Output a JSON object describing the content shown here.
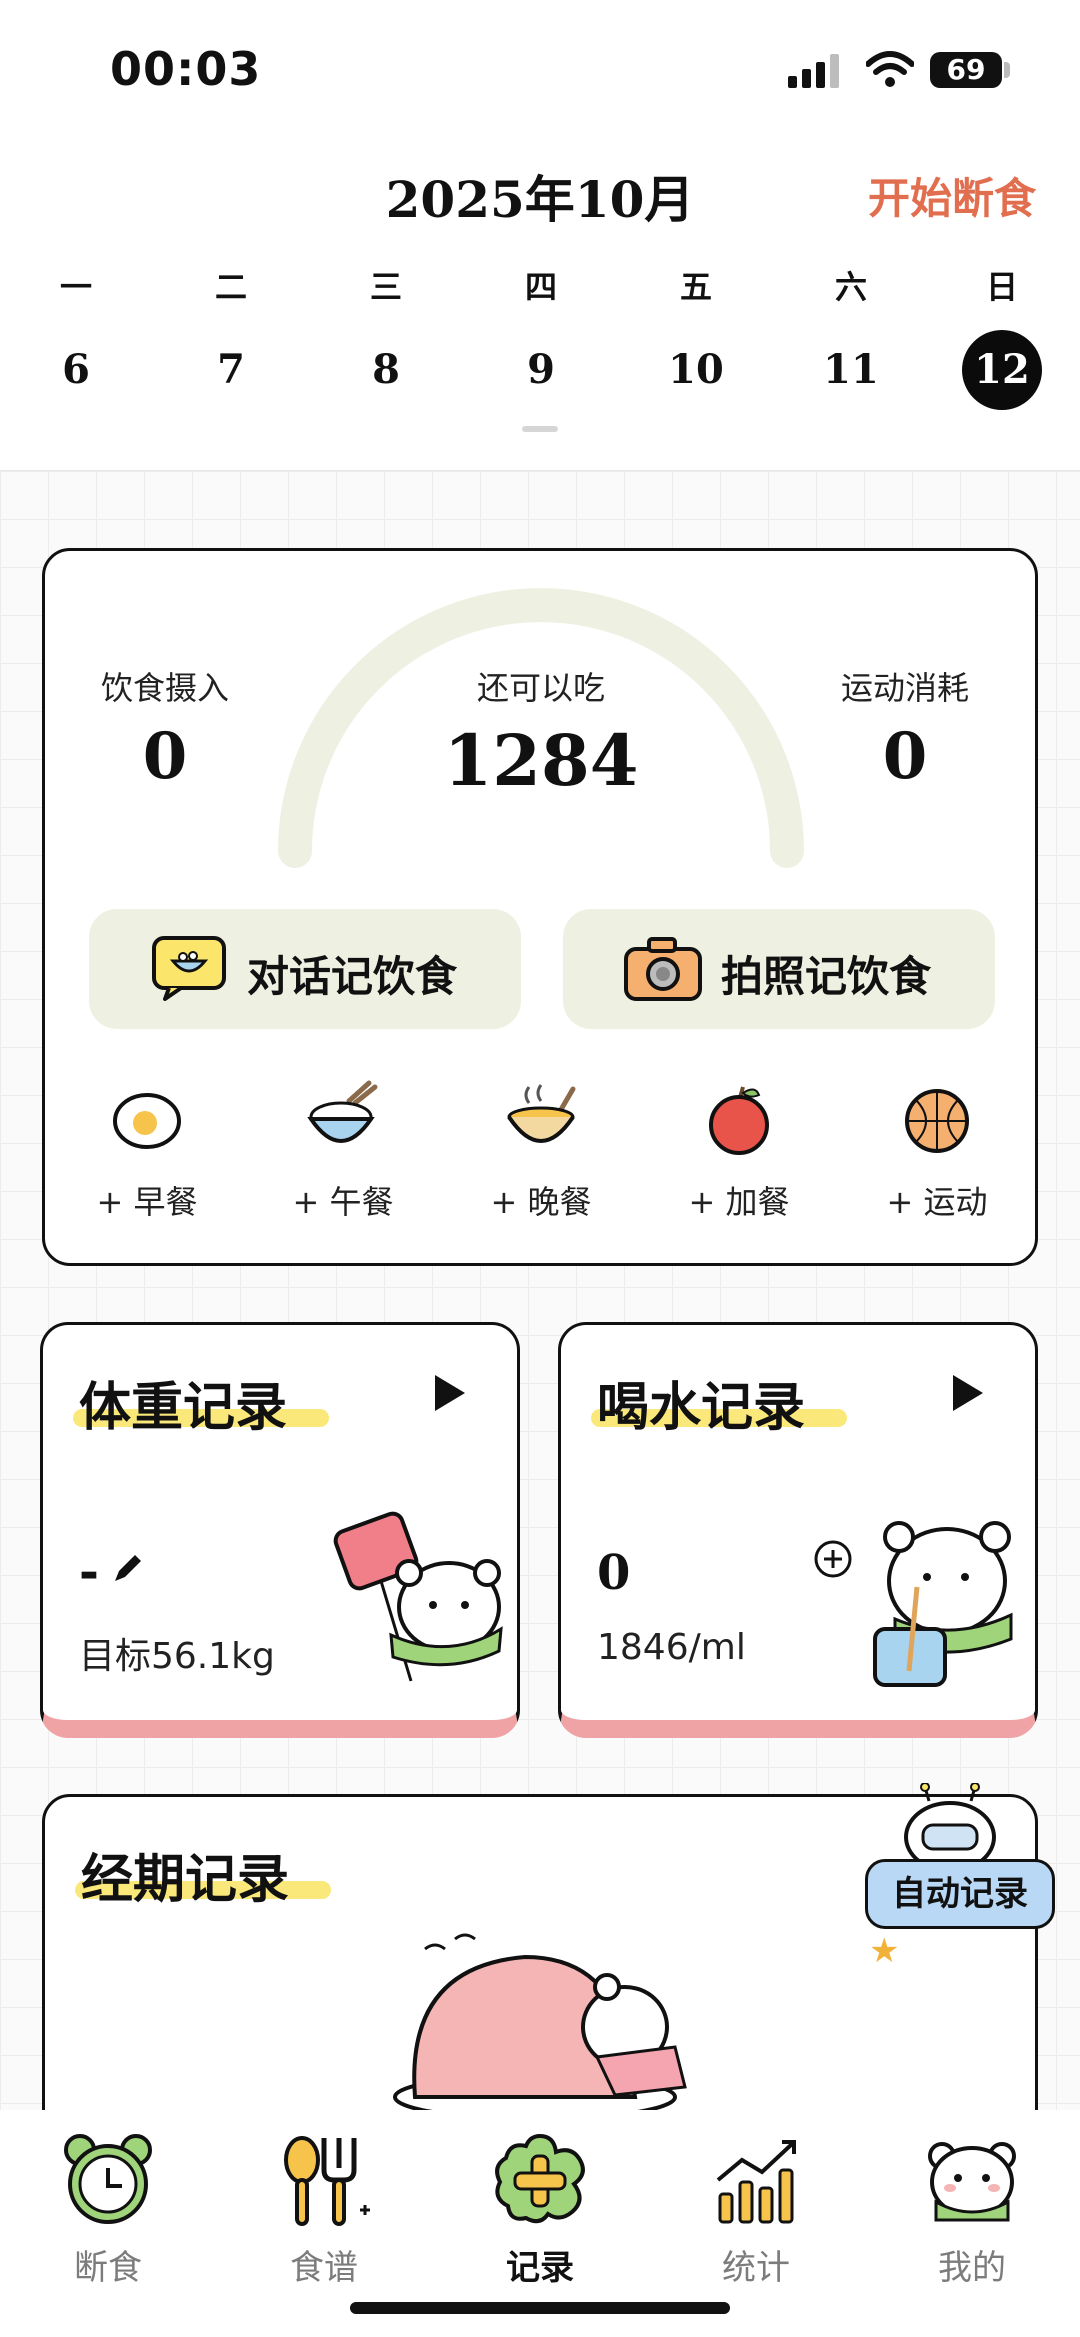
{
  "status": {
    "time": "00:03",
    "battery": "69"
  },
  "calendar": {
    "month_title": "2025年10月",
    "start_fasting": "开始断食",
    "weekdays": [
      "一",
      "二",
      "三",
      "四",
      "五",
      "六",
      "日"
    ],
    "days": [
      "6",
      "7",
      "8",
      "9",
      "10",
      "11",
      "12"
    ],
    "selected_day": "12"
  },
  "calorie": {
    "intake_label": "饮食摄入",
    "intake_value": "0",
    "remaining_label": "还可以吃",
    "remaining_value": "1284",
    "burn_label": "运动消耗",
    "burn_value": "0",
    "chat_button": "对话记饮食",
    "photo_button": "拍照记饮食",
    "meals": [
      {
        "label": "+ 早餐",
        "icon": "fried-egg-icon"
      },
      {
        "label": "+ 午餐",
        "icon": "rice-bowl-icon"
      },
      {
        "label": "+ 晚餐",
        "icon": "soup-bowl-icon"
      },
      {
        "label": "+ 加餐",
        "icon": "apple-icon"
      },
      {
        "label": "+ 运动",
        "icon": "basketball-icon"
      }
    ]
  },
  "weight": {
    "title": "体重记录",
    "value": "-",
    "goal": "目标56.1kg"
  },
  "water": {
    "title": "喝水记录",
    "value": "0",
    "goal": "1846/ml"
  },
  "period": {
    "title": "经期记录",
    "auto_badge": "自动记录"
  },
  "tabs": [
    {
      "label": "断食",
      "icon": "alarm-clock-icon"
    },
    {
      "label": "食谱",
      "icon": "utensils-icon"
    },
    {
      "label": "记录",
      "icon": "add-record-icon"
    },
    {
      "label": "统计",
      "icon": "bar-chart-icon"
    },
    {
      "label": "我的",
      "icon": "bear-profile-icon"
    }
  ],
  "active_tab": "记录",
  "colors": {
    "accent": "#e16e4f",
    "soft_green": "#eef1e2",
    "card_pink": "#f0a3a5",
    "highlight": "#fbe66b"
  }
}
